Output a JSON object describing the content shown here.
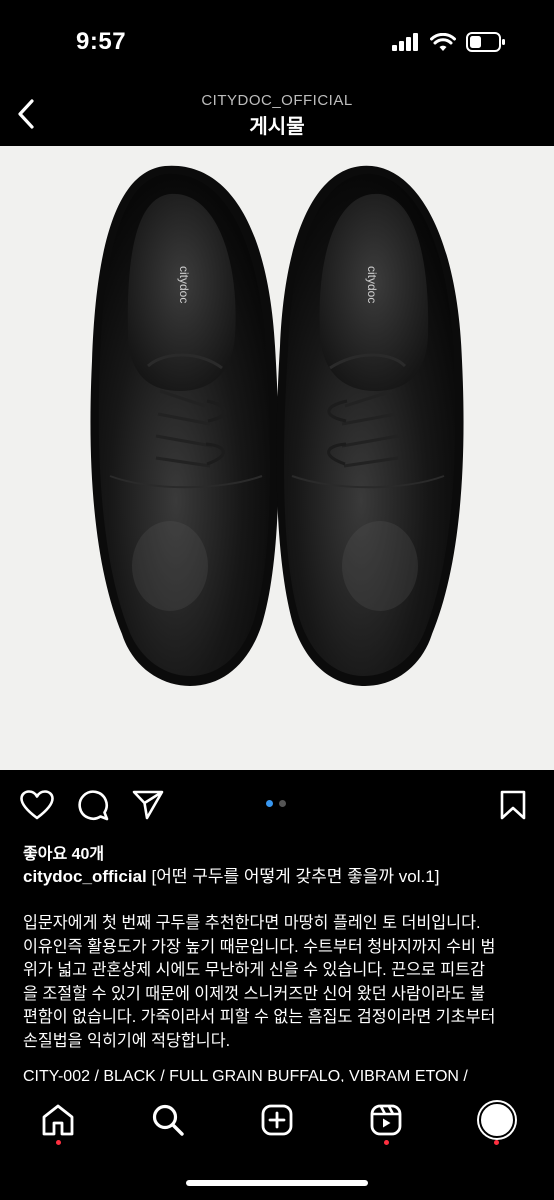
{
  "status": {
    "time": "9:57"
  },
  "header": {
    "account": "CITYDOC_OFFICIAL",
    "title": "게시물"
  },
  "image": {
    "brand_mark": "citydoc"
  },
  "actions": {
    "like_icon": "heart-icon",
    "comment_icon": "comment-icon",
    "share_icon": "send-icon",
    "save_icon": "bookmark-icon",
    "carousel": {
      "current": 1,
      "total": 2
    }
  },
  "post": {
    "likes": "좋아요 40개",
    "username": "citydoc_official",
    "title": "[어떤 구두를 어떻게 갖추면 좋을까 vol.1]",
    "body_lines": [
      "입문자에게 첫 번째 구두를 추천한다면 마땅히 플레인 토 더비입니다.",
      "이유인즉 활용도가 가장 높기 때문입니다. 수트부터 청바지까지 수비 범",
      "위가 넓고 관혼상제 시에도 무난하게 신을 수 있습니다. 끈으로 피트감",
      "을 조절할 수 있기 때문에 이제껏 스니커즈만 신어 왔던 사람이라도 불",
      "편함이 없습니다. 가죽이라서 피할 수 없는 흠집도 검정이라면 기초부터",
      "손질법을 익히기에 적당합니다."
    ],
    "product": "CITY-002 / BLACK / FULL GRAIN BUFFALO, VIBRAM ETON /"
  },
  "nav": {
    "tabs": [
      "home",
      "search",
      "create",
      "reels",
      "profile"
    ]
  },
  "colors": {
    "accent": "#3897f0",
    "notification": "#ff3040",
    "image_bg": "#f1f1ef"
  }
}
